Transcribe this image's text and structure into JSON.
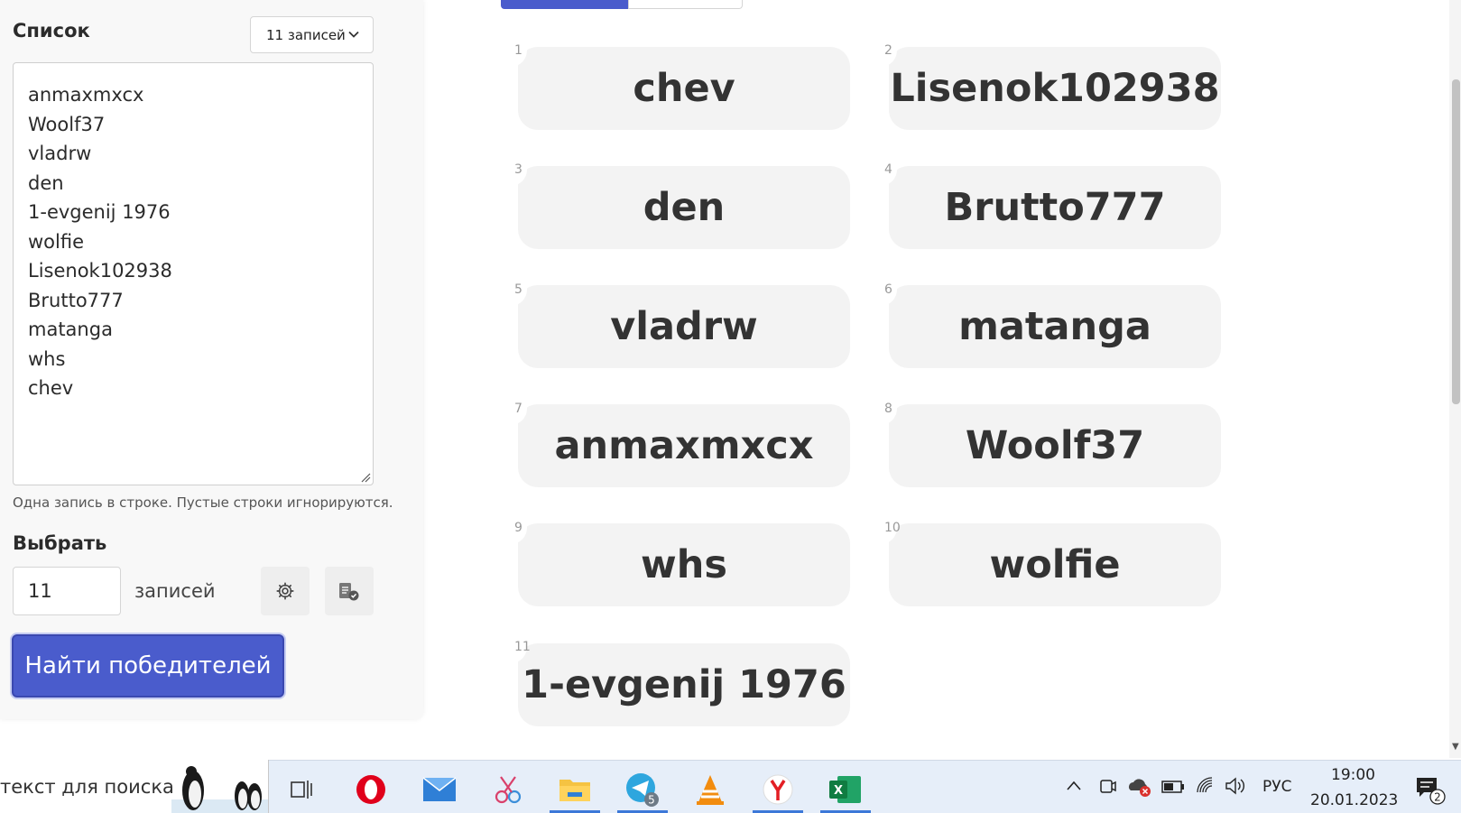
{
  "panel": {
    "title": "Список",
    "count_select": "11 записей",
    "entries": [
      "anmaxmxcx",
      "Woolf37",
      "vladrw",
      "den",
      "1-evgenij 1976",
      "wolfie",
      "Lisenok102938",
      "Brutto777",
      "matanga",
      "whs",
      "chev"
    ],
    "hint": "Одна запись в строке. Пустые строки игнорируются.",
    "pick_title": "Выбрать",
    "pick_count": "11",
    "records_label": "записей",
    "find_button": "Найти победителей"
  },
  "results": [
    {
      "num": "1",
      "name": "chev"
    },
    {
      "num": "2",
      "name": "Lisenok102938"
    },
    {
      "num": "3",
      "name": "den"
    },
    {
      "num": "4",
      "name": "Brutto777"
    },
    {
      "num": "5",
      "name": "vladrw"
    },
    {
      "num": "6",
      "name": "matanga"
    },
    {
      "num": "7",
      "name": "anmaxmxcx"
    },
    {
      "num": "8",
      "name": "Woolf37"
    },
    {
      "num": "9",
      "name": "whs"
    },
    {
      "num": "10",
      "name": "wolfie"
    },
    {
      "num": "11",
      "name": "1-evgenij 1976"
    }
  ],
  "taskbar": {
    "search_text": "текст для поиска",
    "apps": [
      "task-view",
      "opera",
      "mail",
      "snipping-tool",
      "file-explorer",
      "telegram",
      "vlc",
      "yandex-browser",
      "excel"
    ],
    "telegram_badge": "5",
    "language": "РУС",
    "time": "19:00",
    "date": "20.01.2023",
    "notification_count": "2"
  },
  "colors": {
    "accent": "#4a5ccc",
    "card_bg": "#f3f3f3",
    "panel_bg": "#f8f8f8",
    "taskbar_bg": "#e6eef9"
  }
}
